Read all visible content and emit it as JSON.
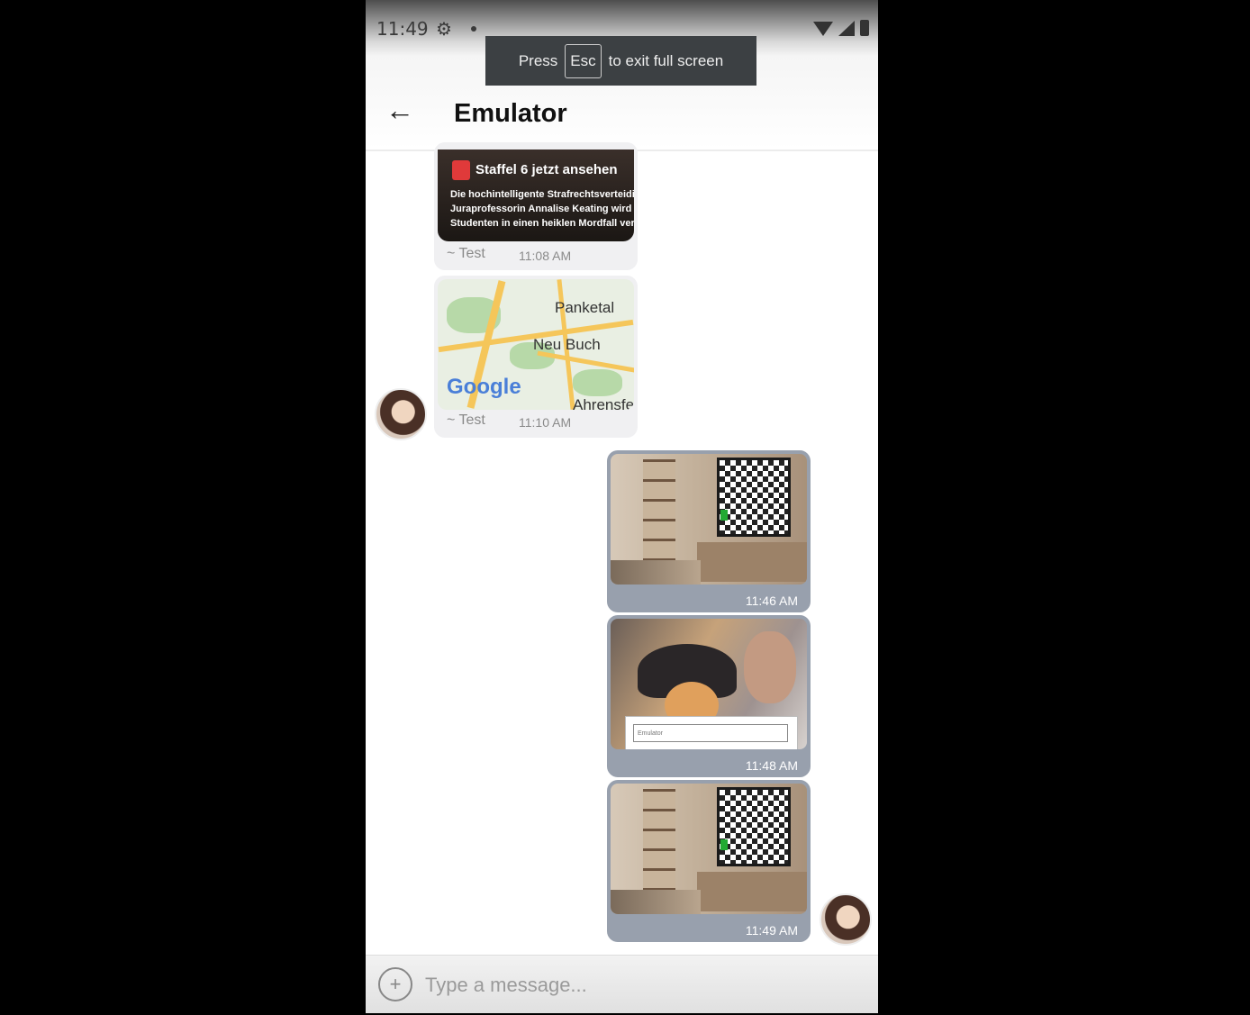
{
  "status_bar": {
    "time": "11:49",
    "icons": [
      "gear-icon",
      "wifi-icon",
      "signal-icon",
      "battery-icon"
    ]
  },
  "fullscreen_toast": {
    "prefix": "Press",
    "key": "Esc",
    "suffix": "to exit full screen"
  },
  "header": {
    "title": "Emulator",
    "back_icon": "arrow-left-icon"
  },
  "messages": [
    {
      "type": "received-link-preview",
      "preview_title": "Staffel 6 jetzt ansehen",
      "preview_lines": [
        "Die hochintelligente Strafrechtsverteidi",
        "Juraprofessorin Annalise Keating wird n",
        "Studenten in einen heiklen Mordfall ver"
      ],
      "sender": "~ Test",
      "time": "11:08 AM"
    },
    {
      "type": "received-location",
      "map_labels": [
        "Panketal",
        "Neu Buch",
        "Ahrensfe"
      ],
      "map_brand": "Google",
      "sender": "~ Test",
      "time": "11:10 AM"
    },
    {
      "type": "sent-image",
      "time": "11:46 AM"
    },
    {
      "type": "sent-image",
      "time": "11:48 AM",
      "caption_text": "Emulator"
    },
    {
      "type": "sent-image",
      "time": "11:49 AM"
    }
  ],
  "composer": {
    "placeholder": "Type a message...",
    "attach_icon": "plus-circle-icon"
  }
}
